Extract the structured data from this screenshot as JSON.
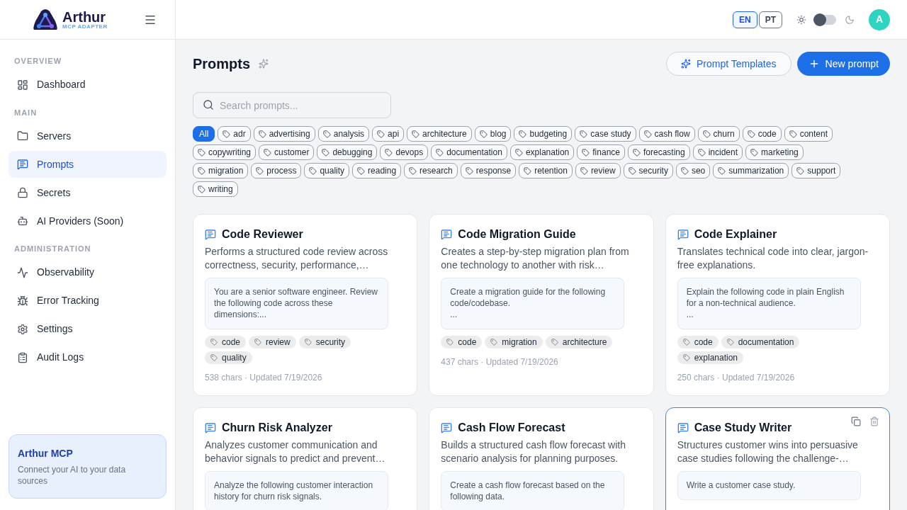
{
  "brand": {
    "name": "Arthur",
    "subtitle": "MCP ADAPTER"
  },
  "sidebar": {
    "sections": [
      {
        "title": "OVERVIEW",
        "items": [
          {
            "label": "Dashboard",
            "selected": false
          }
        ]
      },
      {
        "title": "MAIN",
        "items": [
          {
            "label": "Servers",
            "selected": false
          },
          {
            "label": "Prompts",
            "selected": true
          },
          {
            "label": "Secrets",
            "selected": false
          },
          {
            "label": "AI Providers (Soon)",
            "selected": false
          }
        ]
      },
      {
        "title": "ADMINISTRATION",
        "items": [
          {
            "label": "Observability",
            "selected": false
          },
          {
            "label": "Error Tracking",
            "selected": false
          },
          {
            "label": "Settings",
            "selected": false
          },
          {
            "label": "Audit Logs",
            "selected": false
          }
        ]
      }
    ],
    "promo": {
      "title": "Arthur MCP",
      "text": "Connect your AI to your data sources"
    }
  },
  "header": {
    "languages": [
      {
        "label": "EN",
        "selected": true
      },
      {
        "label": "PT",
        "selected": false
      }
    ],
    "dark_mode": false,
    "avatar": "A"
  },
  "page": {
    "title": "Prompts",
    "buttons": [
      {
        "label": "Prompt Templates",
        "kind": "outline"
      },
      {
        "label": "New prompt",
        "kind": "primary"
      }
    ],
    "search": {
      "placeholder": "Search prompts..."
    },
    "filters": [
      {
        "label": "All",
        "selected": true
      },
      {
        "label": "adr",
        "selected": false
      },
      {
        "label": "advertising",
        "selected": false
      },
      {
        "label": "analysis",
        "selected": false
      },
      {
        "label": "api",
        "selected": false
      },
      {
        "label": "architecture",
        "selected": false
      },
      {
        "label": "blog",
        "selected": false
      },
      {
        "label": "budgeting",
        "selected": false
      },
      {
        "label": "case study",
        "selected": false
      },
      {
        "label": "cash flow",
        "selected": false
      },
      {
        "label": "churn",
        "selected": false
      },
      {
        "label": "code",
        "selected": false
      },
      {
        "label": "content",
        "selected": false
      },
      {
        "label": "copywriting",
        "selected": false
      },
      {
        "label": "customer",
        "selected": false
      },
      {
        "label": "debugging",
        "selected": false
      },
      {
        "label": "devops",
        "selected": false
      },
      {
        "label": "documentation",
        "selected": false
      },
      {
        "label": "explanation",
        "selected": false
      },
      {
        "label": "finance",
        "selected": false
      },
      {
        "label": "forecasting",
        "selected": false
      },
      {
        "label": "incident",
        "selected": false
      },
      {
        "label": "marketing",
        "selected": false
      },
      {
        "label": "migration",
        "selected": false
      },
      {
        "label": "process",
        "selected": false
      },
      {
        "label": "quality",
        "selected": false
      },
      {
        "label": "reading",
        "selected": false
      },
      {
        "label": "research",
        "selected": false
      },
      {
        "label": "response",
        "selected": false
      },
      {
        "label": "retention",
        "selected": false
      },
      {
        "label": "review",
        "selected": false
      },
      {
        "label": "security",
        "selected": false
      },
      {
        "label": "seo",
        "selected": false
      },
      {
        "label": "summarization",
        "selected": false
      },
      {
        "label": "support",
        "selected": false
      },
      {
        "label": "writing",
        "selected": false
      }
    ],
    "cards": [
      {
        "title": "Code Reviewer",
        "description": "Performs a structured code review across correctness, security, performance,…",
        "preview": "You are a senior software engineer. Review the following code across these dimensions:...",
        "tags": [
          "code",
          "review",
          "security",
          "quality"
        ],
        "meta": "538 chars · Updated 7/19/2026",
        "highlighted": false
      },
      {
        "title": "Code Migration Guide",
        "description": "Creates a step-by-step migration plan from one technology to another with risk…",
        "preview": "Create a migration guide for the following code/codebase.\n...",
        "tags": [
          "code",
          "migration",
          "architecture"
        ],
        "meta": "437 chars · Updated 7/19/2026",
        "highlighted": false
      },
      {
        "title": "Code Explainer",
        "description": "Translates technical code into clear, jargon-free explanations.",
        "preview": "Explain the following code in plain English for a non-technical audience.\n...",
        "tags": [
          "code",
          "documentation",
          "explanation"
        ],
        "meta": "250 chars · Updated 7/19/2026",
        "highlighted": false
      },
      {
        "title": "Churn Risk Analyzer",
        "description": "Analyzes customer communication and behavior signals to predict and prevent…",
        "preview": "Analyze the following customer interaction history for churn risk signals.",
        "highlighted": false
      },
      {
        "title": "Cash Flow Forecast",
        "description": "Builds a structured cash flow forecast with scenario analysis for planning purposes.",
        "preview": "Create a cash flow forecast based on the following data.",
        "highlighted": false
      },
      {
        "title": "Case Study Writer",
        "description": "Structures customer wins into persuasive case studies following the challenge-…",
        "preview": "Write a customer case study.",
        "highlighted": true
      }
    ]
  }
}
